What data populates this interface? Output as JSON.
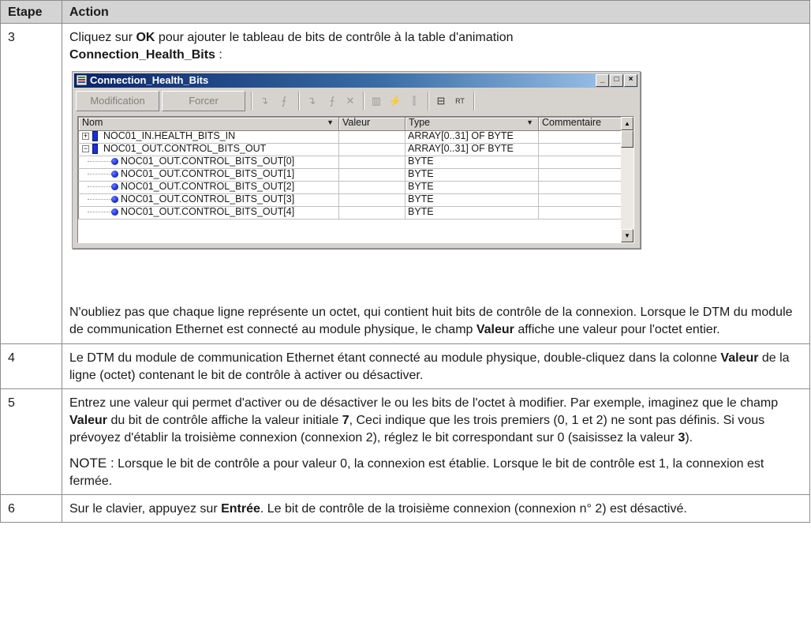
{
  "table": {
    "header": {
      "step": "Etape",
      "action": "Action"
    },
    "step3": {
      "num": "3",
      "intro_a": "Cliquez sur ",
      "intro_ok": "OK",
      "intro_b": " pour ajouter le tableau de bits de contrôle à la table d'animation ",
      "intro_table": "Connection_Health_Bits",
      "intro_c": " :",
      "note_a": "N'oubliez pas que chaque ligne représente un octet, qui contient huit bits de contrôle de la connexion. Lorsque le DTM du module de communication Ethernet est connecté au module physique, le champ ",
      "note_valeur": "Valeur",
      "note_b": " affiche une valeur pour l'octet entier."
    },
    "step4": {
      "num": "4",
      "text_a": "Le DTM du module de communication Ethernet étant connecté au module physique, double-cliquez dans la colonne ",
      "text_valeur": "Valeur",
      "text_b": " de la ligne (octet) contenant le bit de contrôle à activer ou désactiver."
    },
    "step5": {
      "num": "5",
      "text_a": "Entrez une valeur qui permet d'activer ou de désactiver le ou les bits de l'octet à modifier. Par exemple, imaginez que le champ ",
      "text_valeur": "Valeur",
      "text_b": " du bit de contrôle affiche la valeur initiale ",
      "text_7": "7",
      "text_c": ", Ceci indique que les trois premiers (0, 1 et 2) ne sont pas définis. Si vous prévoyez d'établir la troisième connexion (connexion 2), réglez le bit correspondant sur 0 (saisissez la valeur ",
      "text_3": "3",
      "text_d": ").",
      "note_label": "NOTE :",
      "note_text": " Lorsque le bit de contrôle a pour valeur 0, la connexion est établie. Lorsque le bit de contrôle est 1, la connexion est fermée."
    },
    "step6": {
      "num": "6",
      "text_a": "Sur le clavier, appuyez sur ",
      "text_entree": "Entrée",
      "text_b": ". Le bit de contrôle de la troisième connexion (connexion n° 2) est désactivé."
    }
  },
  "window": {
    "title": "Connection_Health_Bits",
    "buttons": {
      "minimize": "_",
      "maximize": "□",
      "close": "×"
    },
    "toolbar": {
      "modification": "Modification",
      "forcer": "Forcer"
    },
    "columns": {
      "nom": "Nom",
      "valeur": "Valeur",
      "type": "Type",
      "commentaire": "Commentaire"
    },
    "rows": [
      {
        "name": "NOC01_IN.HEALTH_BITS_IN",
        "value": "",
        "type": "ARRAY[0..31] OF BYTE",
        "comment": "",
        "kind": "parent",
        "expander": "+"
      },
      {
        "name": "NOC01_OUT.CONTROL_BITS_OUT",
        "value": "",
        "type": "ARRAY[0..31] OF BYTE",
        "comment": "",
        "kind": "parent",
        "expander": "−"
      },
      {
        "name": "NOC01_OUT.CONTROL_BITS_OUT[0]",
        "value": "",
        "type": "BYTE",
        "comment": "",
        "kind": "child"
      },
      {
        "name": "NOC01_OUT.CONTROL_BITS_OUT[1]",
        "value": "",
        "type": "BYTE",
        "comment": "",
        "kind": "child"
      },
      {
        "name": "NOC01_OUT.CONTROL_BITS_OUT[2]",
        "value": "",
        "type": "BYTE",
        "comment": "",
        "kind": "child"
      },
      {
        "name": "NOC01_OUT.CONTROL_BITS_OUT[3]",
        "value": "",
        "type": "BYTE",
        "comment": "",
        "kind": "child"
      },
      {
        "name": "NOC01_OUT.CONTROL_BITS_OUT[4]",
        "value": "",
        "type": "BYTE",
        "comment": "",
        "kind": "child"
      }
    ]
  }
}
